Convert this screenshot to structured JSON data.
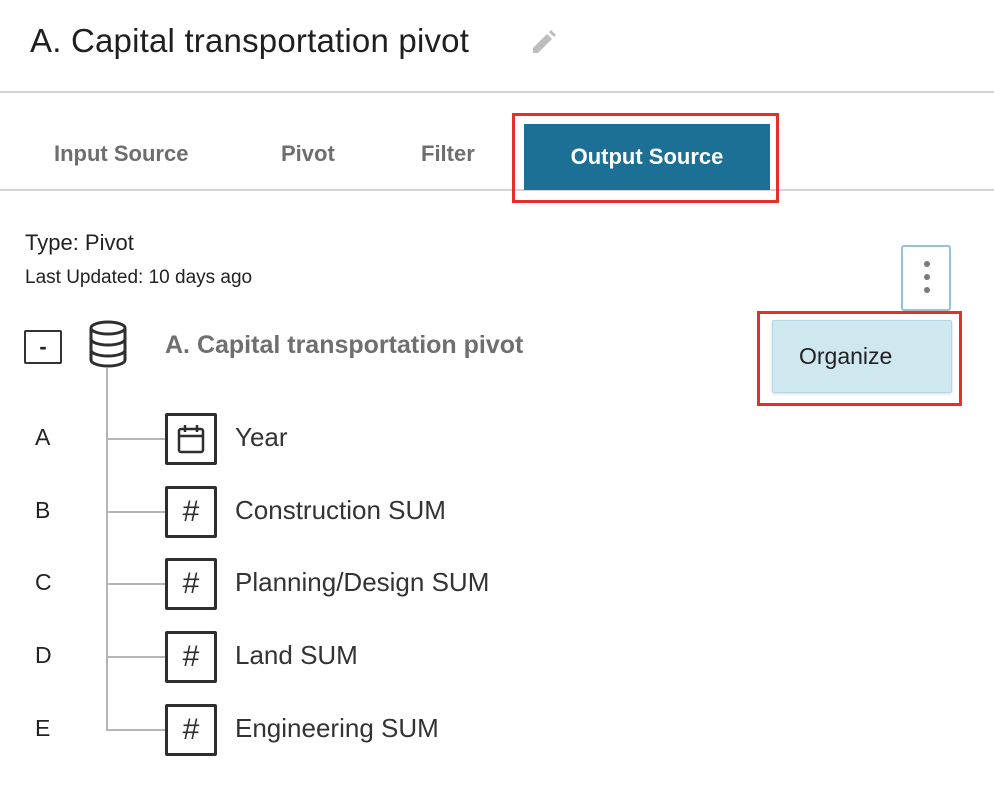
{
  "header": {
    "title": "A. Capital transportation pivot",
    "edit_icon": "pencil-icon"
  },
  "tabs": [
    {
      "label": "Input Source",
      "active": false
    },
    {
      "label": "Pivot",
      "active": false
    },
    {
      "label": "Filter",
      "active": false
    },
    {
      "label": "Output Source",
      "active": true
    }
  ],
  "info": {
    "type": "Type: Pivot",
    "last_updated": "Last Updated: 10 days ago"
  },
  "menu": {
    "icon": "kebab-menu-icon",
    "items": [
      {
        "label": "Organize"
      }
    ]
  },
  "tree": {
    "collapse_label": "-",
    "source_icon": "database-icon",
    "source_name": "A. Capital transportation pivot",
    "columns": [
      {
        "letter": "A",
        "icon": "calendar-icon",
        "label": "Year"
      },
      {
        "letter": "B",
        "icon": "hash-icon",
        "label": "Construction SUM"
      },
      {
        "letter": "C",
        "icon": "hash-icon",
        "label": "Planning/Design SUM"
      },
      {
        "letter": "D",
        "icon": "hash-icon",
        "label": "Land SUM"
      },
      {
        "letter": "E",
        "icon": "hash-icon",
        "label": "Engineering SUM"
      }
    ]
  },
  "colors": {
    "accent": "#1c6f95",
    "highlight": "#e3302b",
    "dropdown_bg": "#cfe7ef"
  }
}
